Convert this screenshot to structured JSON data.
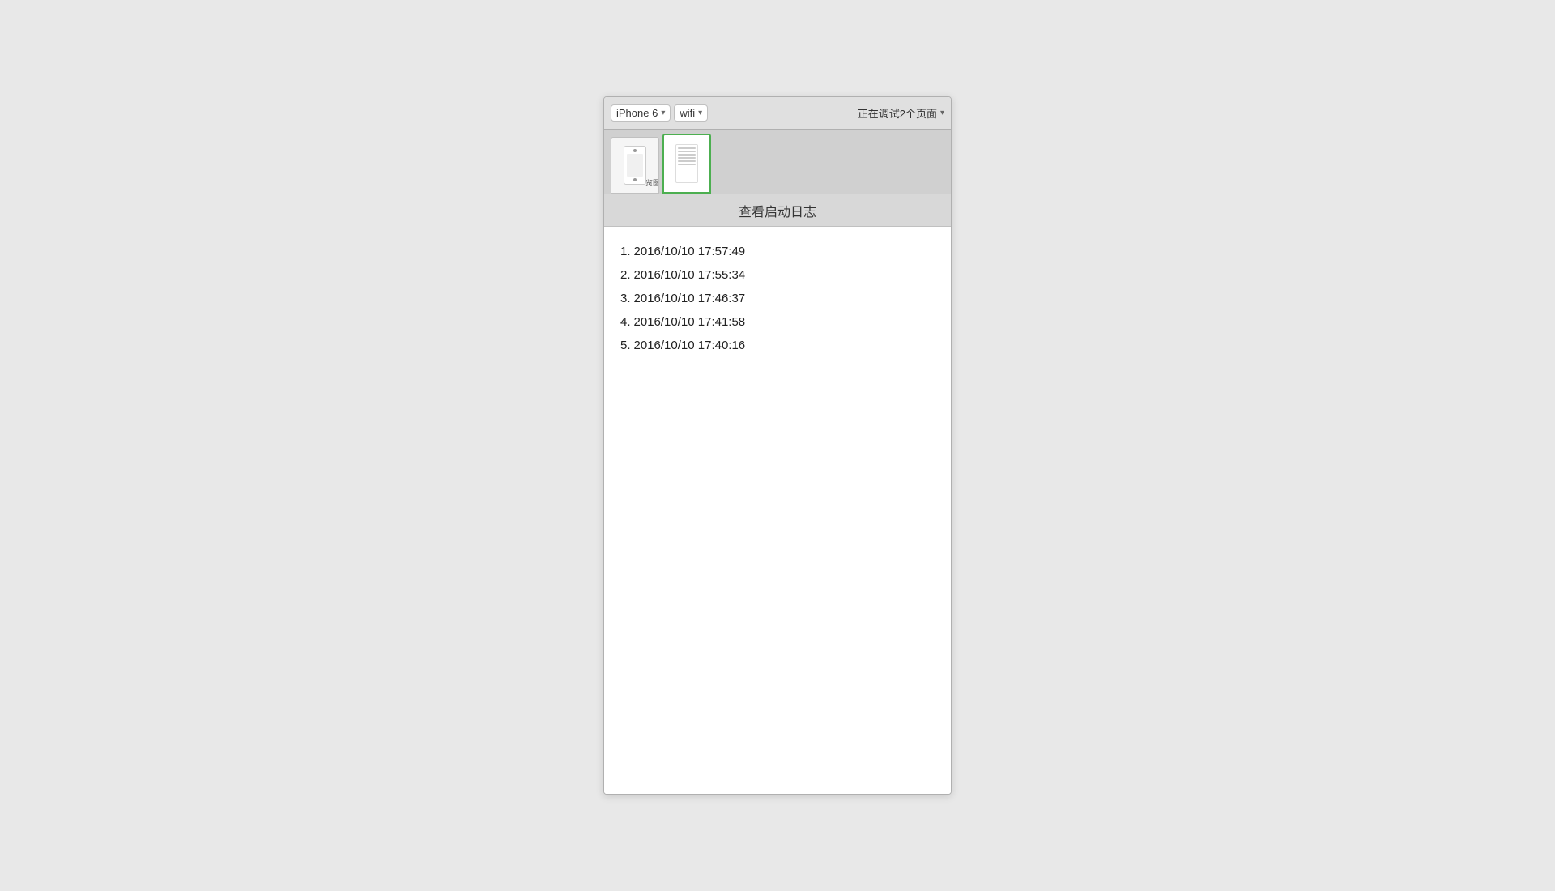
{
  "toolbar": {
    "device_label": "iPhone 6",
    "network_label": "wifi",
    "status_label": "正在调试2个页面",
    "chevron": "▾"
  },
  "tabs": [
    {
      "id": "tab-1",
      "active": false,
      "partial_label": "览图"
    },
    {
      "id": "tab-2",
      "active": true
    }
  ],
  "page": {
    "header_title": "查看启动日志",
    "log_entries": [
      {
        "number": "1.",
        "timestamp": "2016/10/10 17:57:49"
      },
      {
        "number": "2.",
        "timestamp": "2016/10/10 17:55:34"
      },
      {
        "number": "3.",
        "timestamp": "2016/10/10 17:46:37"
      },
      {
        "number": "4.",
        "timestamp": "2016/10/10 17:41:58"
      },
      {
        "number": "5.",
        "timestamp": "2016/10/10 17:40:16"
      }
    ]
  }
}
